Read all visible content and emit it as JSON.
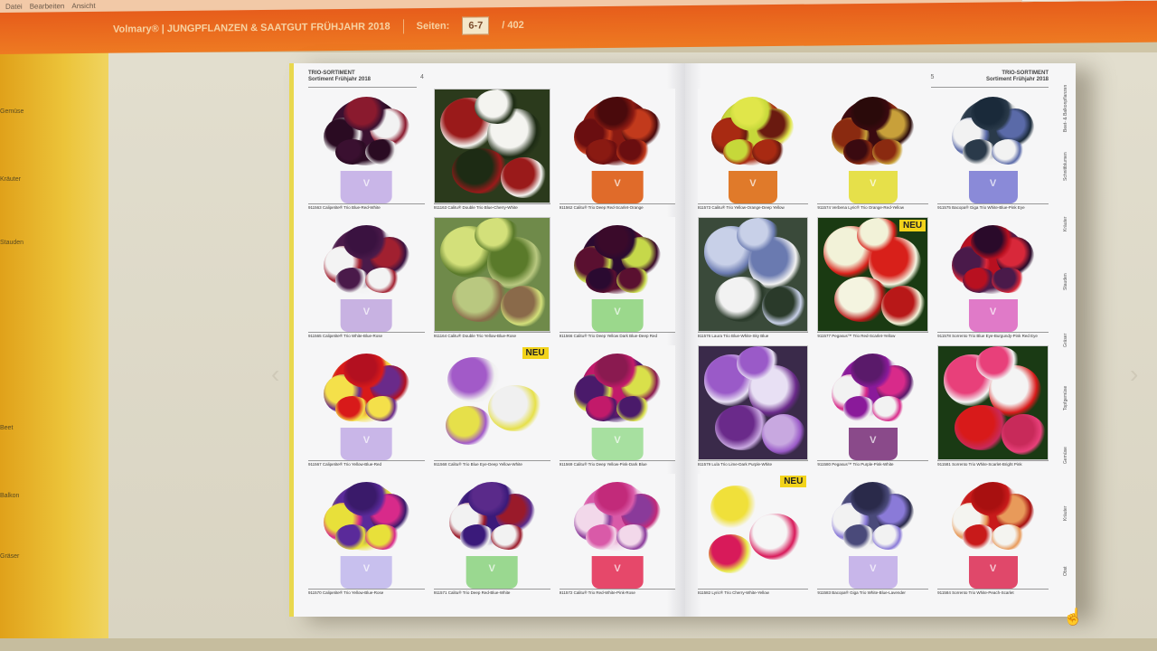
{
  "colors": {
    "accent": "#e45419",
    "neu_badge": "#f2d31a",
    "page_bg": "#f6f6f7"
  },
  "topbar": {
    "menu_small": [
      "Datei",
      "Bearbeiten",
      "Ansicht"
    ],
    "title": "Volmary® | JUNGPFLANZEN & SAATGUT FRÜHJAHR 2018",
    "pages_label": "Seiten:",
    "page_value": "6-7",
    "page_total": "/ 402",
    "search_icon": "search-icon"
  },
  "left_sidebar": {
    "items": [
      "Gemüse",
      "Kräuter",
      "Stauden",
      "Beet",
      "Balkon",
      "Gräser"
    ]
  },
  "book": {
    "left": {
      "header_line1": "TRIO-SORTIMENT",
      "header_line2": "Sortiment Frühjahr 2018",
      "page_number": "4",
      "tiles": [
        {
          "caption": "911563 Calipetite® Trio Blue-Red-White",
          "neu": ""
        },
        {
          "caption": "911163 Calitu® Double Trio Blue-Cherry-White",
          "neu": ""
        },
        {
          "caption": "911562 Calitu® Trio Deep Red-Scarlet-Orange",
          "neu": ""
        },
        {
          "caption": "911565 Calipetite® Trio White-Blue-Rose",
          "neu": ""
        },
        {
          "caption": "911164 Calitu® Double Trio Yellow-Blue-Rose",
          "neu": ""
        },
        {
          "caption": "911566 Calitu® Trio Deep Yellow Dark Blue-Deep Red",
          "neu": ""
        },
        {
          "caption": "911567 Calipetite® Trio Yellow-Blue-Red",
          "neu": ""
        },
        {
          "caption": "911568 Calitu® Trio Blue Eye-Deep Yellow-White",
          "neu": "NEU"
        },
        {
          "caption": "911569 Calitu® Trio Deep Yellow-Pink-Dark Blue",
          "neu": ""
        },
        {
          "caption": "911570 Calipetite® Trio Yellow-Blue-Rose",
          "neu": ""
        },
        {
          "caption": "911571 Calitu® Trio Deep Red-Blue-White",
          "neu": ""
        },
        {
          "caption": "911572 Calitu® Trio Red-White-Pink-Rose",
          "neu": ""
        }
      ]
    },
    "right": {
      "header_line1": "TRIO-SORTIMENT",
      "header_line2": "Sortiment Frühjahr 2018",
      "page_number": "5",
      "side_tabs": [
        "Beet- & Balkonpflanzen",
        "Schnittblumen",
        "Kräuter",
        "Stauden",
        "Gräser",
        "Topfgemüse",
        "Gemüse",
        "Kräuter",
        "Obst"
      ],
      "tiles": [
        {
          "caption": "911573 Calitu® Trio Yellow-Orange-Deep Yellow",
          "neu": ""
        },
        {
          "caption": "911574 Verbena Lyric® Trio Orange-Red-Yellow",
          "neu": ""
        },
        {
          "caption": "911575 Bacopa® Giga Trio White-Blue-Pink Eye",
          "neu": ""
        },
        {
          "caption": "911576 Laura Trio Blue-White-Sky Blue",
          "neu": ""
        },
        {
          "caption": "911577 Pegasus™ Trio Red-Scarlet-Yellow",
          "neu": "NEU"
        },
        {
          "caption": "911578 Sorrento Trio Blue Eye-Burgundy-Pink Red Eye",
          "neu": ""
        },
        {
          "caption": "911579 Lula Trio Lime-Dark Purple-White",
          "neu": ""
        },
        {
          "caption": "911580 Pegasus™ Trio Purple-Pink-White",
          "neu": ""
        },
        {
          "caption": "911581 Sorrento Trio White-Scarlet-Bright Pink",
          "neu": ""
        },
        {
          "caption": "911582 Lyric® Trio Cherry-White-Yellow",
          "neu": "NEU"
        },
        {
          "caption": "911583 Bacopa® Giga Trio White-Blue-Lavender",
          "neu": ""
        },
        {
          "caption": "911584 Sorrento Trio White-Peach-Scarlet",
          "neu": ""
        }
      ]
    }
  }
}
